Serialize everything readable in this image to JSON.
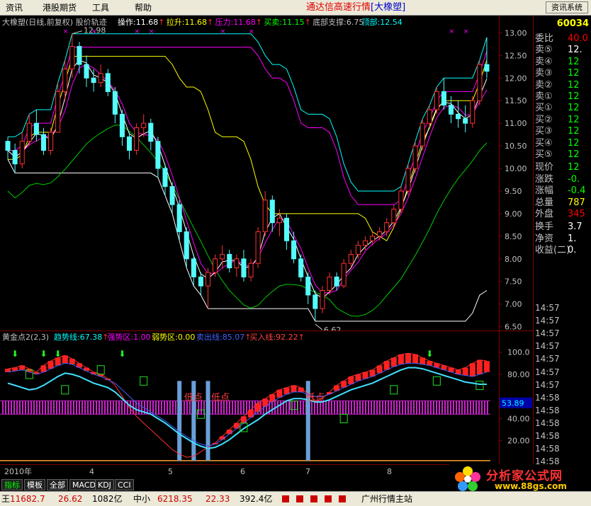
{
  "menubar": {
    "items": [
      "资讯",
      "港股期货",
      "工具",
      "帮助"
    ],
    "title_main": "通达信高速行情",
    "title_bracket": "[大橡塑]",
    "sys_button": "资讯系统"
  },
  "main_header": {
    "name": "大橡塑(日线,前复权) 股价轨迹",
    "items": [
      {
        "label": "操作:11.68",
        "arrow": "↑",
        "color": "#ffffff"
      },
      {
        "label": "拉升:11.68",
        "arrow": "↑",
        "color": "#ffff00"
      },
      {
        "label": "压力:11.68",
        "arrow": "↑",
        "color": "#ff00ff"
      },
      {
        "label": "买卖:11.15",
        "arrow": "↑",
        "color": "#00ff00"
      },
      {
        "label": "底部支撑:6.75",
        "arrow": "",
        "color": "#c0c0c0"
      },
      {
        "label": "顶部:12.54",
        "arrow": "",
        "color": "#00ffff"
      }
    ],
    "high_label": "12.98",
    "low_label": "6.62"
  },
  "ind_header": {
    "name": "黄金点2(2,3)",
    "items": [
      {
        "label": "趋势线:67.38",
        "arrow": "↑",
        "color": "#00ffff"
      },
      {
        "label": "强势区:1.00",
        "arrow": "",
        "color": "#ff00ff"
      },
      {
        "label": "弱势区:0.00",
        "arrow": "",
        "color": "#ffff00"
      },
      {
        "label": "卖出线:85.07",
        "arrow": "↑",
        "color": "#4060ff"
      },
      {
        "label": "买入线:92.22",
        "arrow": "↑",
        "color": "#ff4040"
      }
    ],
    "annotations": [
      "低点",
      "低点",
      "低点"
    ],
    "current_value": "53.89"
  },
  "price_axis": [
    "13.00",
    "12.50",
    "12.00",
    "11.50",
    "11.00",
    "10.50",
    "10.00",
    "9.50",
    "9.00",
    "8.50",
    "8.00",
    "7.50",
    "7.00",
    "6.50"
  ],
  "ind_axis": [
    "100.0",
    "80.00",
    "40.00",
    "20.00"
  ],
  "x_axis": [
    "2010年",
    "4",
    "5",
    "6",
    "7",
    "8"
  ],
  "quote_panel": {
    "code": "60034",
    "rows": [
      {
        "label": "委比",
        "value": "40.0",
        "color": "#ff0000"
      },
      {
        "label": "卖⑤",
        "value": "12.",
        "color": "#ffffff"
      },
      {
        "label": "卖④",
        "value": "12",
        "color": "#00ff00"
      },
      {
        "label": "卖③",
        "value": "12",
        "color": "#00ff00"
      },
      {
        "label": "卖②",
        "value": "12",
        "color": "#00ff00"
      },
      {
        "label": "卖①",
        "value": "12",
        "color": "#00ff00"
      },
      {
        "label": "买①",
        "value": "12",
        "color": "#00ff00"
      },
      {
        "label": "买②",
        "value": "12",
        "color": "#00ff00"
      },
      {
        "label": "买③",
        "value": "12",
        "color": "#00ff00"
      },
      {
        "label": "买④",
        "value": "12",
        "color": "#00ff00"
      },
      {
        "label": "买⑤",
        "value": "12",
        "color": "#00ff00"
      },
      {
        "label": "现价",
        "value": "12",
        "color": "#00ff00"
      },
      {
        "label": "涨跌",
        "value": "-0.",
        "color": "#00ff00"
      },
      {
        "label": "涨幅",
        "value": "-0.4",
        "color": "#00ff00"
      },
      {
        "label": "总量",
        "value": "787",
        "color": "#ffff00"
      },
      {
        "label": "外盘",
        "value": "345",
        "color": "#ff0000"
      },
      {
        "label": "换手",
        "value": "3.7",
        "color": "#ffffff"
      },
      {
        "label": "净资",
        "value": "1.",
        "color": "#ffffff"
      },
      {
        "label": "收益(二)",
        "value": "0.",
        "color": "#ffffff"
      }
    ],
    "ticks": [
      "14:57",
      "14:57",
      "14:57",
      "14:57",
      "14:57",
      "14:57",
      "14:57",
      "14:58",
      "14:58",
      "14:58",
      "14:58",
      "14:58",
      "14:58",
      "14:58",
      "14:58"
    ]
  },
  "tabs": [
    "指标",
    "模板",
    "全部",
    "MACD",
    "KDJ",
    "CCI"
  ],
  "status": [
    {
      "text": "11682.7",
      "color": "#cc0000"
    },
    {
      "text": "26.62",
      "color": "#cc0000"
    },
    {
      "text": "1082亿",
      "color": "#000000"
    },
    {
      "text": "中小",
      "color": "#000000"
    },
    {
      "text": "6218.35",
      "color": "#cc0000"
    },
    {
      "text": "22.33",
      "color": "#cc0000"
    },
    {
      "text": "392.4亿",
      "color": "#000000"
    },
    {
      "text": "广州行情主站",
      "color": "#000000"
    }
  ],
  "logo": {
    "main": "分析家公式网",
    "url": "www.88gs.com"
  },
  "colors": {
    "up": "#ff3232",
    "down": "#54fcfc",
    "grid": "#800000"
  },
  "chart_data": {
    "type": "candlestick",
    "ylim": [
      6.4,
      13.1
    ],
    "candles": [
      [
        10.6,
        10.7,
        10.2,
        10.4
      ],
      [
        10.4,
        10.55,
        9.9,
        10.1
      ],
      [
        10.1,
        10.8,
        10.0,
        10.6
      ],
      [
        10.6,
        11.2,
        10.5,
        11.0
      ],
      [
        11.0,
        11.3,
        10.6,
        10.75
      ],
      [
        10.75,
        10.9,
        10.3,
        10.4
      ],
      [
        10.4,
        10.9,
        10.3,
        10.8
      ],
      [
        10.8,
        11.9,
        10.8,
        11.7
      ],
      [
        11.7,
        12.4,
        11.5,
        12.2
      ],
      [
        12.2,
        12.98,
        12.0,
        12.7
      ],
      [
        12.7,
        12.8,
        12.1,
        12.3
      ],
      [
        12.3,
        12.5,
        11.8,
        12.0
      ],
      [
        12.0,
        12.2,
        11.7,
        11.9
      ],
      [
        11.9,
        12.3,
        11.8,
        12.1
      ],
      [
        12.1,
        12.2,
        11.6,
        11.7
      ],
      [
        11.7,
        11.8,
        11.0,
        11.2
      ],
      [
        11.2,
        11.3,
        10.5,
        10.7
      ],
      [
        10.7,
        10.8,
        10.2,
        10.4
      ],
      [
        10.4,
        11.0,
        10.3,
        10.9
      ],
      [
        10.9,
        11.2,
        10.7,
        11.0
      ],
      [
        11.0,
        11.1,
        10.4,
        10.6
      ],
      [
        10.6,
        10.7,
        9.8,
        10.0
      ],
      [
        10.0,
        10.1,
        9.4,
        9.6
      ],
      [
        9.6,
        9.7,
        9.0,
        9.2
      ],
      [
        9.2,
        9.3,
        8.4,
        8.6
      ],
      [
        8.6,
        8.7,
        7.8,
        8.0
      ],
      [
        8.0,
        8.1,
        7.4,
        7.6
      ],
      [
        7.6,
        7.7,
        7.2,
        7.4
      ],
      [
        7.4,
        7.8,
        6.9,
        7.7
      ],
      [
        7.7,
        8.1,
        7.6,
        8.0
      ],
      [
        8.0,
        8.3,
        7.8,
        8.1
      ],
      [
        8.1,
        8.2,
        7.7,
        7.8
      ],
      [
        7.8,
        8.1,
        7.6,
        8.0
      ],
      [
        8.0,
        8.2,
        7.5,
        7.6
      ],
      [
        7.6,
        8.0,
        7.5,
        7.9
      ],
      [
        7.9,
        8.7,
        7.8,
        8.6
      ],
      [
        8.6,
        9.5,
        8.5,
        9.3
      ],
      [
        9.3,
        9.4,
        8.6,
        8.8
      ],
      [
        8.8,
        9.1,
        8.5,
        8.9
      ],
      [
        8.9,
        9.0,
        8.2,
        8.4
      ],
      [
        8.4,
        8.6,
        7.9,
        8.0
      ],
      [
        8.0,
        8.1,
        7.5,
        7.6
      ],
      [
        7.6,
        7.7,
        7.0,
        7.2
      ],
      [
        7.2,
        7.3,
        6.62,
        6.9
      ],
      [
        6.9,
        7.4,
        6.8,
        7.3
      ],
      [
        7.3,
        7.7,
        7.2,
        7.6
      ],
      [
        7.6,
        7.7,
        7.3,
        7.4
      ],
      [
        7.4,
        8.0,
        7.35,
        7.9
      ],
      [
        7.9,
        8.2,
        7.8,
        8.1
      ],
      [
        8.1,
        8.4,
        8.0,
        8.3
      ],
      [
        8.3,
        8.5,
        8.2,
        8.4
      ],
      [
        8.4,
        8.6,
        8.3,
        8.5
      ],
      [
        8.5,
        8.7,
        8.4,
        8.6
      ],
      [
        8.6,
        8.9,
        8.5,
        8.8
      ],
      [
        8.8,
        9.2,
        8.7,
        9.1
      ],
      [
        9.1,
        9.6,
        9.0,
        9.5
      ],
      [
        9.5,
        10.1,
        9.4,
        10.0
      ],
      [
        10.0,
        10.6,
        9.9,
        10.5
      ],
      [
        10.5,
        11.1,
        10.4,
        11.0
      ],
      [
        11.0,
        11.4,
        10.9,
        11.3
      ],
      [
        11.3,
        11.8,
        11.2,
        11.7
      ],
      [
        11.7,
        12.0,
        11.3,
        11.4
      ],
      [
        11.4,
        11.6,
        11.0,
        11.2
      ],
      [
        11.2,
        11.5,
        10.9,
        11.1
      ],
      [
        11.1,
        11.4,
        10.8,
        11.0
      ],
      [
        11.0,
        11.6,
        10.9,
        11.5
      ],
      [
        11.5,
        12.4,
        11.4,
        12.3
      ],
      [
        12.3,
        12.9,
        12.0,
        12.15
      ]
    ],
    "ind_series": {
      "trend": [
        72,
        70,
        68,
        66,
        67,
        70,
        74,
        78,
        81,
        80,
        78,
        75,
        72,
        70,
        68,
        64,
        58,
        52,
        48,
        46,
        44,
        40,
        36,
        31,
        26,
        22,
        18,
        15,
        13,
        14,
        17,
        21,
        26,
        31,
        35,
        39,
        44,
        48,
        52,
        56,
        58,
        58,
        57,
        55,
        55,
        57,
        60,
        63,
        66,
        68,
        70,
        72,
        75,
        78,
        81,
        84,
        86,
        86,
        85,
        83,
        81,
        79,
        77,
        75,
        73,
        72,
        71,
        71
      ],
      "sell": [
        82,
        83,
        84,
        82,
        80,
        82,
        85,
        88,
        90,
        89,
        86,
        83,
        80,
        78,
        75,
        72,
        66,
        60,
        54,
        50,
        46,
        42,
        38,
        33,
        28,
        24,
        20,
        17,
        15,
        17,
        21,
        26,
        31,
        36,
        41,
        46,
        51,
        55,
        59,
        62,
        64,
        64,
        62,
        60,
        60,
        62,
        65,
        68,
        71,
        74,
        76,
        78,
        81,
        84,
        87,
        89,
        90,
        90,
        89,
        88,
        86,
        84,
        82,
        80,
        79,
        78,
        80,
        82
      ],
      "buy": [
        85,
        86,
        88,
        85,
        82,
        88,
        92,
        95,
        97,
        94,
        90,
        86,
        82,
        80,
        76,
        70,
        60,
        50,
        42,
        36,
        30,
        24,
        18,
        12,
        8,
        5,
        6,
        10,
        14,
        18,
        24,
        30,
        36,
        42,
        48,
        54,
        58,
        62,
        66,
        68,
        70,
        68,
        62,
        56,
        58,
        64,
        70,
        74,
        78,
        80,
        82,
        84,
        88,
        92,
        95,
        98,
        99,
        98,
        95,
        92,
        90,
        88,
        86,
        84,
        86,
        90,
        93,
        92
      ]
    }
  }
}
